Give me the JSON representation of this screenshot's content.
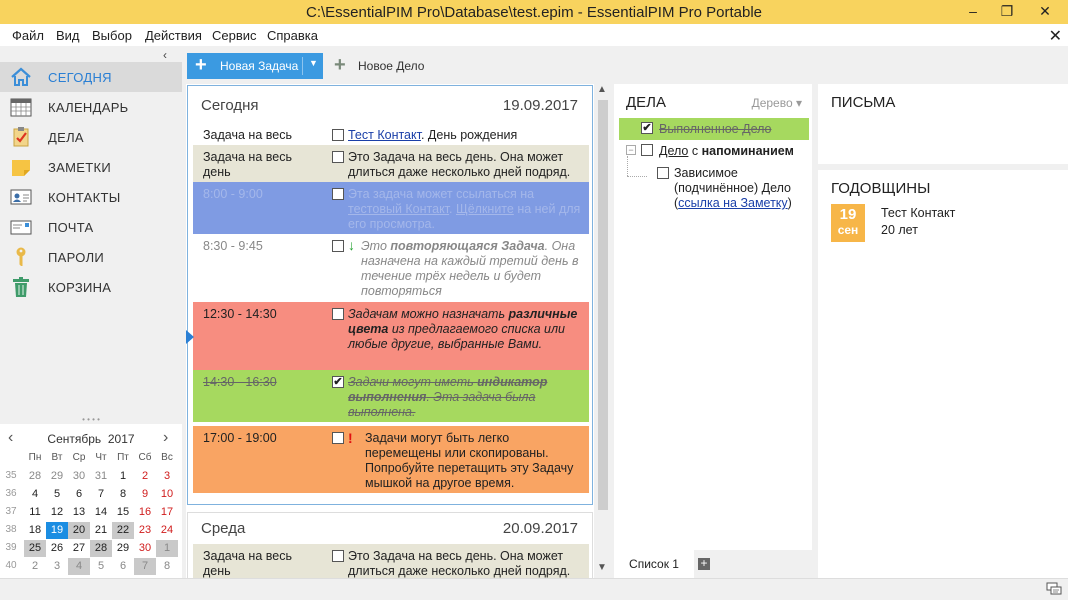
{
  "window": {
    "title": "C:\\EssentialPIM Pro\\Database\\test.epim - EssentialPIM Pro Portable",
    "min": "–",
    "max": "❐",
    "close": "✕"
  },
  "menu": [
    "Файл",
    "Вид",
    "Выбор",
    "Действия",
    "Сервис",
    "Справка"
  ],
  "menu_close": "✕",
  "sidebar": {
    "collapse": "‹",
    "items": [
      {
        "label": "СЕГОДНЯ",
        "icon": "home-icon"
      },
      {
        "label": "КАЛЕНДАРЬ",
        "icon": "calendar-icon"
      },
      {
        "label": "ДЕЛА",
        "icon": "tasks-icon"
      },
      {
        "label": "ЗАМЕТКИ",
        "icon": "notes-icon"
      },
      {
        "label": "КОНТАКТЫ",
        "icon": "contacts-icon"
      },
      {
        "label": "ПОЧТА",
        "icon": "mail-icon"
      },
      {
        "label": "ПАРОЛИ",
        "icon": "key-icon"
      },
      {
        "label": "КОРЗИНА",
        "icon": "trash-icon"
      }
    ]
  },
  "calendar": {
    "month": "Сентябрь",
    "year": "2017",
    "prev": "‹",
    "next": "›",
    "day_names": [
      "Пн",
      "Вт",
      "Ср",
      "Чт",
      "Пт",
      "Сб",
      "Вс"
    ],
    "weeks": [
      {
        "num": "35",
        "days": [
          "28",
          "29",
          "30",
          "31",
          "1",
          "2",
          "3"
        ]
      },
      {
        "num": "36",
        "days": [
          "4",
          "5",
          "6",
          "7",
          "8",
          "9",
          "10"
        ]
      },
      {
        "num": "37",
        "days": [
          "11",
          "12",
          "13",
          "14",
          "15",
          "16",
          "17"
        ]
      },
      {
        "num": "38",
        "days": [
          "18",
          "19",
          "20",
          "21",
          "22",
          "23",
          "24"
        ]
      },
      {
        "num": "39",
        "days": [
          "25",
          "26",
          "27",
          "28",
          "29",
          "30",
          "1"
        ]
      },
      {
        "num": "40",
        "days": [
          "2",
          "3",
          "4",
          "5",
          "6",
          "7",
          "8"
        ]
      }
    ]
  },
  "toolbar": {
    "new_task": "Новая Задача",
    "new_item": "Новое Дело",
    "dropdown": "▼",
    "plus": "+"
  },
  "today": {
    "day_label": "Сегодня",
    "date": "19.09.2017",
    "rows": [
      {
        "time": "Задача на весь",
        "link": "Тест Контакт",
        "text": ". День рождения"
      },
      {
        "time": "Задача на весь день",
        "text": "Это Задача на весь день. Она может длиться даже несколько дней подряд."
      },
      {
        "time": "8:00 - 9:00",
        "t1": "Эта задача может ссылаться на ",
        "l1": "тестовый Контакт",
        "t2": ". ",
        "l2": "Щёлкните",
        "t3": " на ней для его просмотра."
      },
      {
        "time": "8:30 - 9:45",
        "mark": "↓",
        "t1": "Это ",
        "b1": "повторяющаяся Задача",
        "t2": ". Она назначена на каждый третий день в течение трёх недель и будет повторяться"
      },
      {
        "time": "12:30 - 14:30",
        "t1": "Задачам можно назначать ",
        "b1": "различные цвета",
        "t2": " из предлагаемого списка или любые другие, выбранные Вами."
      },
      {
        "time": "14:30 - 16:30",
        "check": "✔",
        "t1": "Задачи могут иметь ",
        "b1": "индикатор выполнения",
        "t2": ". Эта задача была выполнена."
      },
      {
        "time": "17:00 - 19:00",
        "mark": "!",
        "text": "Задачи могут быть легко перемещены или скопированы. Попробуйте перетащить эту Задачу мышкой на другое время."
      }
    ]
  },
  "wednesday": {
    "day_label": "Среда",
    "date": "20.09.2017",
    "rows": [
      {
        "time": "Задача на весь день",
        "text": "Это Задача на весь день. Она может длиться даже несколько дней подряд."
      }
    ]
  },
  "scroll": {
    "up": "▲",
    "down": "▼"
  },
  "items_panel": {
    "title": "ДЕЛА",
    "view": "Дерево ▾",
    "items": [
      {
        "text": "Выполненное Дело",
        "check": "✔"
      },
      {
        "expander": "−",
        "t1": "Дело",
        "t2": " с ",
        "b1": "напоминанием"
      },
      {
        "t1": "Зависимое (подчинённое) Дело (",
        "link": "ссылка на Заметку",
        "t2": ")"
      }
    ],
    "tab": "Список 1",
    "add": "+"
  },
  "mail_panel": {
    "title": "ПИСЬМА"
  },
  "anniv_panel": {
    "title": "ГОДОВЩИНЫ",
    "day": "19",
    "month": "сен",
    "name": "Тест Контакт",
    "years": "20 лет"
  },
  "colors": {
    "titlebar": "#f8d35e",
    "accent": "#3b9ae1",
    "row_allday": "#e7e5d6",
    "row_blue": "#7f9be3",
    "row_red": "#f78d80",
    "row_green": "#a6d95f",
    "row_orange": "#f9a463",
    "anniv_badge": "#f7b648"
  }
}
